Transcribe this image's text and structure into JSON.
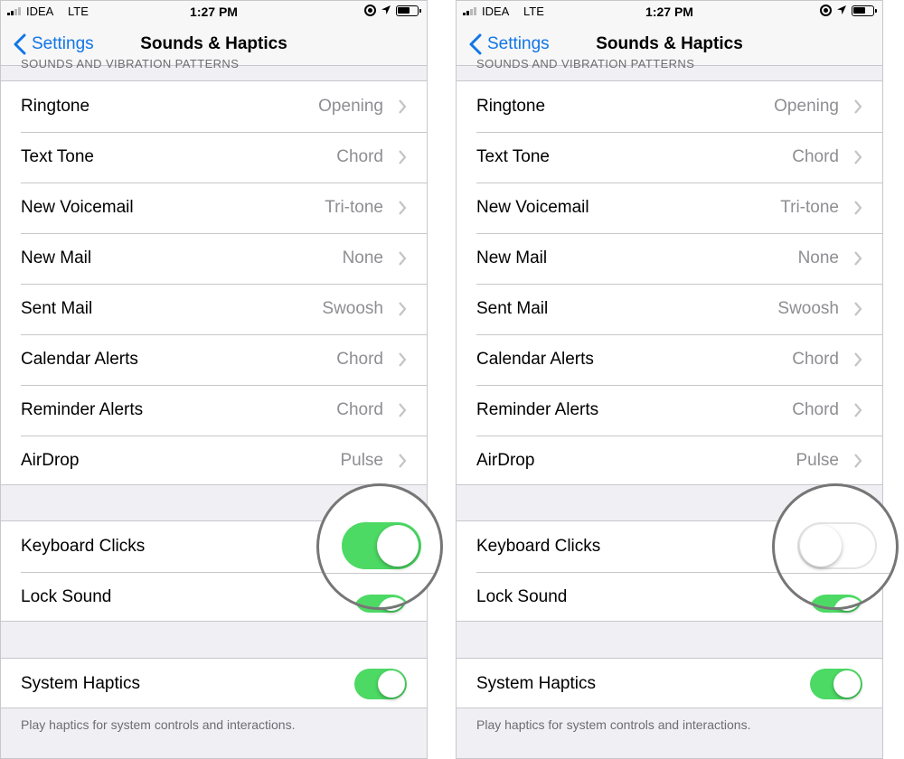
{
  "status_bar": {
    "carrier": "IDEA",
    "network": "LTE",
    "time": "1:27 PM"
  },
  "nav": {
    "back_label": "Settings",
    "title": "Sounds & Haptics"
  },
  "section_header": "Sounds and Vibration Patterns",
  "sounds": [
    {
      "label": "Ringtone",
      "value": "Opening"
    },
    {
      "label": "Text Tone",
      "value": "Chord"
    },
    {
      "label": "New Voicemail",
      "value": "Tri-tone"
    },
    {
      "label": "New Mail",
      "value": "None"
    },
    {
      "label": "Sent Mail",
      "value": "Swoosh"
    },
    {
      "label": "Calendar Alerts",
      "value": "Chord"
    },
    {
      "label": "Reminder Alerts",
      "value": "Chord"
    },
    {
      "label": "AirDrop",
      "value": "Pulse"
    }
  ],
  "toggles": {
    "keyboard_clicks": "Keyboard Clicks",
    "lock_sound": "Lock Sound",
    "system_haptics": "System Haptics"
  },
  "footer_note": "Play haptics for system controls and interactions.",
  "state": {
    "left": {
      "keyboard_clicks_on": true,
      "lock_sound_on": true,
      "system_haptics_on": true
    },
    "right": {
      "keyboard_clicks_on": false,
      "lock_sound_on": true,
      "system_haptics_on": true
    }
  },
  "colors": {
    "accent": "#1176e8",
    "switch_on": "#4cd964",
    "magnifier_ring": "#767676"
  }
}
